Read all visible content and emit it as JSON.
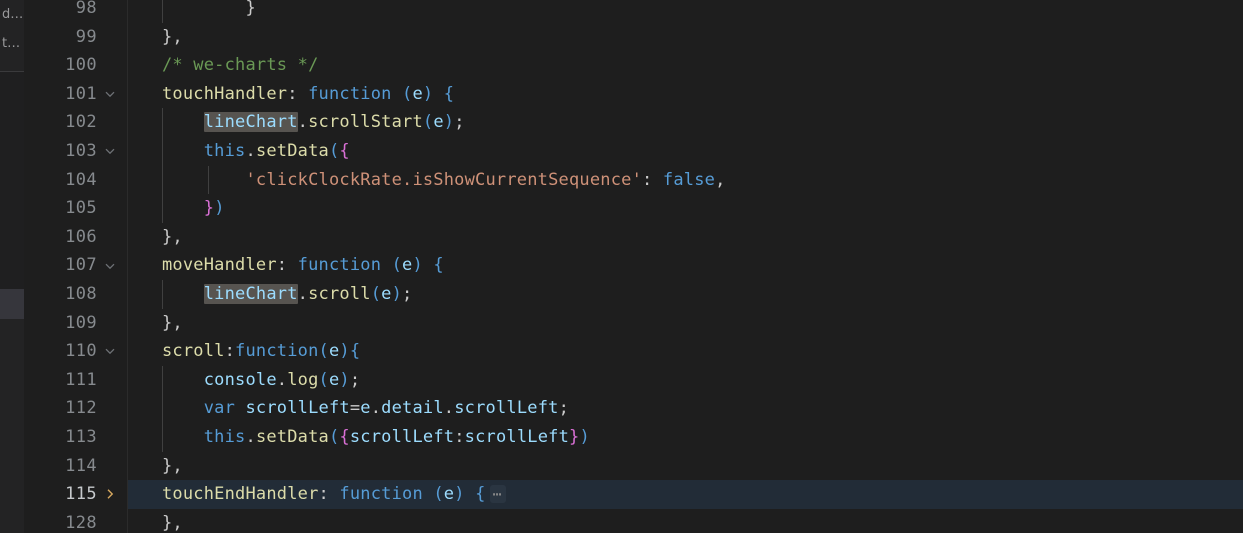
{
  "side_panel": {
    "rows": [
      {
        "label": "d…"
      },
      {
        "label": "t…"
      }
    ]
  },
  "editor": {
    "language": "javascript",
    "colors": {
      "background": "#1e1e1e",
      "gutter_foreground": "#868a8e",
      "active_line_background": "#222c37",
      "occurrence_highlight": "#575450",
      "comment": "#6a9955",
      "keyword": "#569cd6",
      "string": "#ce9178",
      "function": "#dcdcaa",
      "variable": "#9cdcfe"
    },
    "fold_placeholder": "⋯",
    "active_line_number": "115",
    "lines": [
      {
        "number": "98",
        "fold": "none",
        "active": false,
        "guides": 1,
        "indent": 3,
        "tokens": [
          {
            "text": "}",
            "cls": "t-punc"
          }
        ]
      },
      {
        "number": "99",
        "fold": "none",
        "active": false,
        "guides": 0,
        "indent": 1,
        "tokens": [
          {
            "text": "},",
            "cls": "t-punc"
          }
        ]
      },
      {
        "number": "100",
        "fold": "none",
        "active": false,
        "guides": 0,
        "indent": 1,
        "tokens": [
          {
            "text": "/* we-charts */",
            "cls": "t-comment"
          }
        ]
      },
      {
        "number": "101",
        "fold": "open",
        "active": false,
        "guides": 0,
        "indent": 1,
        "tokens": [
          {
            "text": "touchHandler",
            "cls": "t-prop"
          },
          {
            "text": ": ",
            "cls": "t-punc"
          },
          {
            "text": "function",
            "cls": "t-keyword"
          },
          {
            "text": " ",
            "cls": "t-plain"
          },
          {
            "text": "(",
            "cls": "t-paren"
          },
          {
            "text": "e",
            "cls": "t-var"
          },
          {
            "text": ")",
            "cls": "t-paren"
          },
          {
            "text": " ",
            "cls": "t-plain"
          },
          {
            "text": "{",
            "cls": "t-paren"
          }
        ]
      },
      {
        "number": "102",
        "fold": "none",
        "active": false,
        "guides": 1,
        "indent": 2,
        "tokens": [
          {
            "text": "lineChart",
            "cls": "t-occur"
          },
          {
            "text": ".",
            "cls": "t-punc"
          },
          {
            "text": "scrollStart",
            "cls": "t-func"
          },
          {
            "text": "(",
            "cls": "t-paren"
          },
          {
            "text": "e",
            "cls": "t-var"
          },
          {
            "text": ")",
            "cls": "t-paren"
          },
          {
            "text": ";",
            "cls": "t-punc"
          }
        ]
      },
      {
        "number": "103",
        "fold": "open",
        "active": false,
        "guides": 1,
        "indent": 2,
        "tokens": [
          {
            "text": "this",
            "cls": "t-keyword"
          },
          {
            "text": ".",
            "cls": "t-punc"
          },
          {
            "text": "setData",
            "cls": "t-func"
          },
          {
            "text": "(",
            "cls": "t-paren"
          },
          {
            "text": "{",
            "cls": "t-paren2"
          }
        ]
      },
      {
        "number": "104",
        "fold": "none",
        "active": false,
        "guides": 2,
        "indent": 3,
        "tokens": [
          {
            "text": "'clickClockRate.isShowCurrentSequence'",
            "cls": "t-string"
          },
          {
            "text": ": ",
            "cls": "t-punc"
          },
          {
            "text": "false",
            "cls": "t-bool"
          },
          {
            "text": ",",
            "cls": "t-punc"
          }
        ]
      },
      {
        "number": "105",
        "fold": "none",
        "active": false,
        "guides": 1,
        "indent": 2,
        "tokens": [
          {
            "text": "}",
            "cls": "t-paren2"
          },
          {
            "text": ")",
            "cls": "t-paren"
          }
        ]
      },
      {
        "number": "106",
        "fold": "none",
        "active": false,
        "guides": 0,
        "indent": 1,
        "tokens": [
          {
            "text": "},",
            "cls": "t-punc"
          }
        ]
      },
      {
        "number": "107",
        "fold": "open",
        "active": false,
        "guides": 0,
        "indent": 1,
        "tokens": [
          {
            "text": "moveHandler",
            "cls": "t-prop"
          },
          {
            "text": ": ",
            "cls": "t-punc"
          },
          {
            "text": "function",
            "cls": "t-keyword"
          },
          {
            "text": " ",
            "cls": "t-plain"
          },
          {
            "text": "(",
            "cls": "t-paren"
          },
          {
            "text": "e",
            "cls": "t-var"
          },
          {
            "text": ")",
            "cls": "t-paren"
          },
          {
            "text": " ",
            "cls": "t-plain"
          },
          {
            "text": "{",
            "cls": "t-paren"
          }
        ]
      },
      {
        "number": "108",
        "fold": "none",
        "active": false,
        "guides": 1,
        "indent": 2,
        "tokens": [
          {
            "text": "lineChart",
            "cls": "t-occur"
          },
          {
            "text": ".",
            "cls": "t-punc"
          },
          {
            "text": "scroll",
            "cls": "t-func"
          },
          {
            "text": "(",
            "cls": "t-paren"
          },
          {
            "text": "e",
            "cls": "t-var"
          },
          {
            "text": ")",
            "cls": "t-paren"
          },
          {
            "text": ";",
            "cls": "t-punc"
          }
        ]
      },
      {
        "number": "109",
        "fold": "none",
        "active": false,
        "guides": 0,
        "indent": 1,
        "tokens": [
          {
            "text": "},",
            "cls": "t-punc"
          }
        ]
      },
      {
        "number": "110",
        "fold": "open",
        "active": false,
        "guides": 0,
        "indent": 1,
        "tokens": [
          {
            "text": "scroll",
            "cls": "t-prop"
          },
          {
            "text": ":",
            "cls": "t-punc"
          },
          {
            "text": "function",
            "cls": "t-keyword"
          },
          {
            "text": "(",
            "cls": "t-paren"
          },
          {
            "text": "e",
            "cls": "t-var"
          },
          {
            "text": ")",
            "cls": "t-paren"
          },
          {
            "text": "{",
            "cls": "t-paren"
          }
        ]
      },
      {
        "number": "111",
        "fold": "none",
        "active": false,
        "guides": 1,
        "indent": 2,
        "tokens": [
          {
            "text": "console",
            "cls": "t-var"
          },
          {
            "text": ".",
            "cls": "t-punc"
          },
          {
            "text": "log",
            "cls": "t-func"
          },
          {
            "text": "(",
            "cls": "t-paren"
          },
          {
            "text": "e",
            "cls": "t-var"
          },
          {
            "text": ")",
            "cls": "t-paren"
          },
          {
            "text": ";",
            "cls": "t-punc"
          }
        ]
      },
      {
        "number": "112",
        "fold": "none",
        "active": false,
        "guides": 1,
        "indent": 2,
        "tokens": [
          {
            "text": "var",
            "cls": "t-keyword"
          },
          {
            "text": " ",
            "cls": "t-plain"
          },
          {
            "text": "scrollLeft",
            "cls": "t-var"
          },
          {
            "text": "=",
            "cls": "t-punc"
          },
          {
            "text": "e",
            "cls": "t-var"
          },
          {
            "text": ".",
            "cls": "t-punc"
          },
          {
            "text": "detail",
            "cls": "t-var"
          },
          {
            "text": ".",
            "cls": "t-punc"
          },
          {
            "text": "scrollLeft",
            "cls": "t-var"
          },
          {
            "text": ";",
            "cls": "t-punc"
          }
        ]
      },
      {
        "number": "113",
        "fold": "none",
        "active": false,
        "guides": 1,
        "indent": 2,
        "tokens": [
          {
            "text": "this",
            "cls": "t-keyword"
          },
          {
            "text": ".",
            "cls": "t-punc"
          },
          {
            "text": "setData",
            "cls": "t-func"
          },
          {
            "text": "(",
            "cls": "t-paren"
          },
          {
            "text": "{",
            "cls": "t-paren2"
          },
          {
            "text": "scrollLeft",
            "cls": "t-var"
          },
          {
            "text": ":",
            "cls": "t-punc"
          },
          {
            "text": "scrollLeft",
            "cls": "t-var"
          },
          {
            "text": "}",
            "cls": "t-paren2"
          },
          {
            "text": ")",
            "cls": "t-paren"
          }
        ]
      },
      {
        "number": "114",
        "fold": "none",
        "active": false,
        "guides": 0,
        "indent": 1,
        "tokens": [
          {
            "text": "},",
            "cls": "t-punc"
          }
        ]
      },
      {
        "number": "115",
        "fold": "collapsed",
        "active": true,
        "guides": 0,
        "indent": 1,
        "tokens": [
          {
            "text": "touchEndHandler",
            "cls": "t-prop"
          },
          {
            "text": ": ",
            "cls": "t-punc"
          },
          {
            "text": "function",
            "cls": "t-keyword"
          },
          {
            "text": " ",
            "cls": "t-plain"
          },
          {
            "text": "(",
            "cls": "t-paren"
          },
          {
            "text": "e",
            "cls": "t-var"
          },
          {
            "text": ")",
            "cls": "t-paren"
          },
          {
            "text": " ",
            "cls": "t-plain"
          },
          {
            "text": "{",
            "cls": "t-paren"
          }
        ],
        "folded": true
      },
      {
        "number": "128",
        "fold": "none",
        "active": false,
        "guides": 0,
        "indent": 1,
        "tokens": [
          {
            "text": "},",
            "cls": "t-punc"
          }
        ]
      }
    ]
  }
}
